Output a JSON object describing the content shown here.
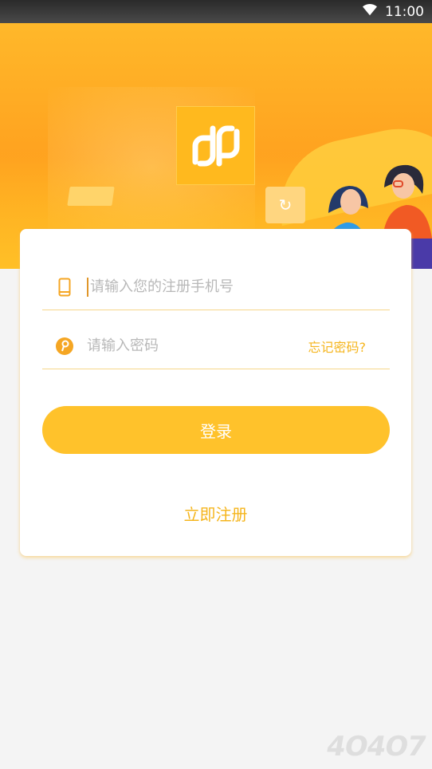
{
  "status_bar": {
    "time": "11:00"
  },
  "login": {
    "phone_placeholder": "请输入您的注册手机号",
    "password_placeholder": "请输入密码",
    "forgot_label": "忘记密码?",
    "login_label": "登录",
    "register_label": "立即注册"
  },
  "icons": {
    "wifi": "wifi-icon",
    "phone": "phone-icon",
    "key": "key-icon",
    "logo": "app-logo"
  },
  "colors": {
    "accent": "#ffc22b",
    "link": "#f5b51d",
    "hero": "#ffa21f"
  },
  "watermark": "4O4O7"
}
